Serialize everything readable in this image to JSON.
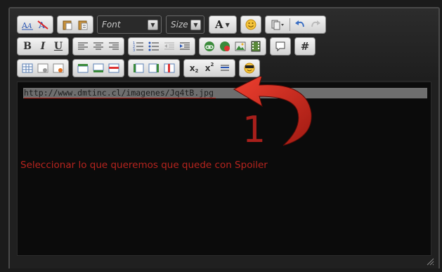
{
  "toolbar": {
    "font_label": "Font",
    "size_label": "Size",
    "font_color_label": "A",
    "bold": "B",
    "italic": "I",
    "underline": "U",
    "code": "#",
    "subscript": "x",
    "subscript_mark": "2",
    "superscript": "x",
    "superscript_mark": "2"
  },
  "editor": {
    "selected_text": "http://www.dmtinc.cl/imagenes/Jq4tB.jpg",
    "step_number": "1",
    "annotation": "Seleccionar lo que queremos que quede con Spoiler"
  },
  "colors": {
    "annotation_red": "#b7241e",
    "selection_gray": "#6e6e6e",
    "editor_bg": "#0b0b0b"
  }
}
